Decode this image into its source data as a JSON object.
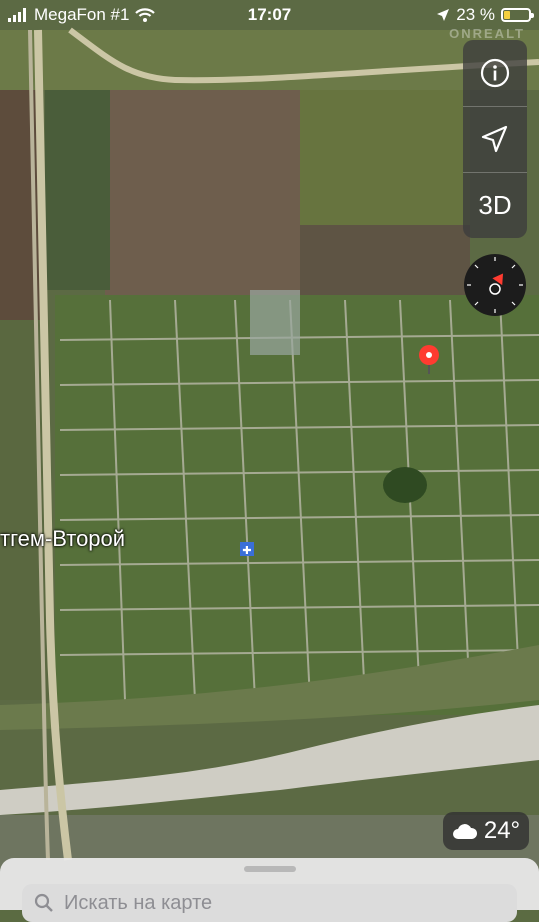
{
  "status_bar": {
    "carrier": "MegaFon #1",
    "time": "17:07",
    "battery_percent": "23 %",
    "battery_level": 0.23
  },
  "watermark": "ONREALT",
  "map_controls": {
    "info_icon": "info-icon",
    "location_icon": "location-arrow-icon",
    "threed_label": "3D"
  },
  "compass_icon": "compass-icon",
  "place_label": "тгем-Второй",
  "weather": {
    "icon": "cloud-icon",
    "temperature": "24°"
  },
  "search": {
    "placeholder": "Искать на карте"
  },
  "pin_icon": "map-pin-icon"
}
